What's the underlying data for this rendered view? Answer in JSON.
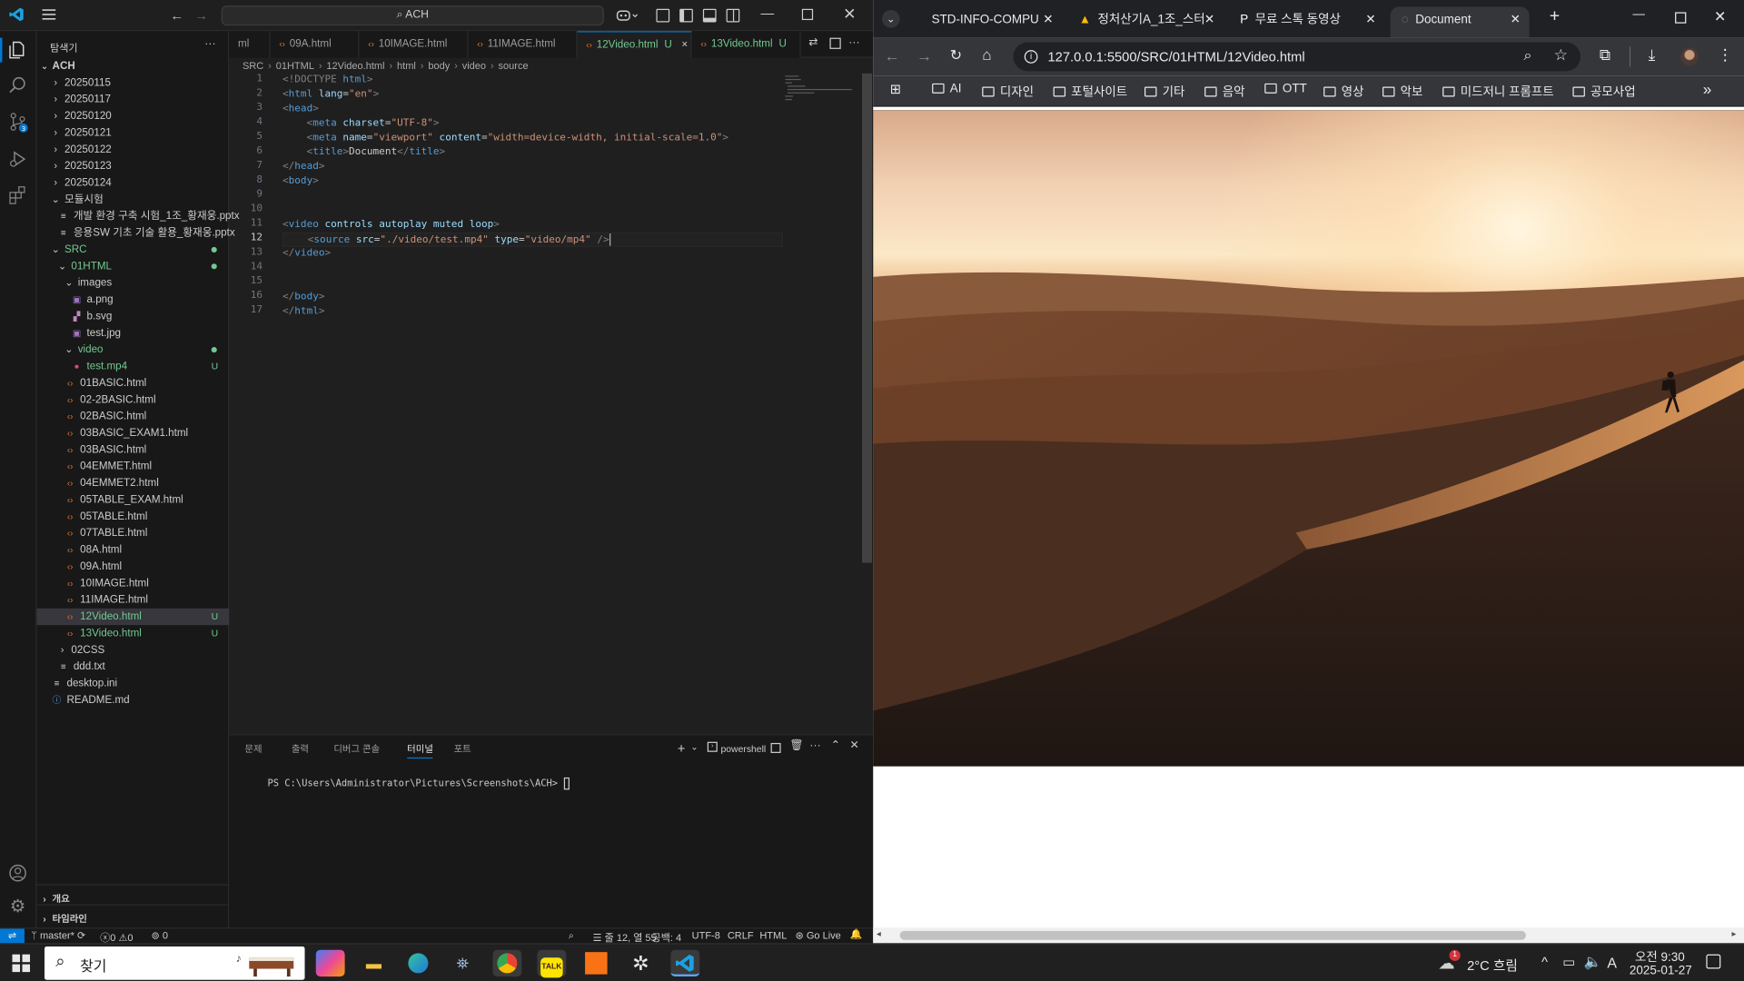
{
  "vscode": {
    "menu_icon": "hamburger-icon",
    "search_text": "ACH",
    "sidebar_title": "탐색기",
    "sidebar_more": "···",
    "root": "ACH",
    "tree": [
      {
        "label": "20250115",
        "kind": "folder",
        "depth": 0,
        "open": false
      },
      {
        "label": "20250117",
        "kind": "folder",
        "depth": 0,
        "open": false
      },
      {
        "label": "20250120",
        "kind": "folder",
        "depth": 0,
        "open": false
      },
      {
        "label": "20250121",
        "kind": "folder",
        "depth": 0,
        "open": false
      },
      {
        "label": "20250122",
        "kind": "folder",
        "depth": 0,
        "open": false
      },
      {
        "label": "20250123",
        "kind": "folder",
        "depth": 0,
        "open": false
      },
      {
        "label": "20250124",
        "kind": "folder",
        "depth": 0,
        "open": false
      },
      {
        "label": "모듈시험",
        "kind": "folder",
        "depth": 0,
        "open": true
      },
      {
        "label": "개발 환경 구축 시험_1조_황재웅.pptx",
        "kind": "file",
        "depth": 1
      },
      {
        "label": "응용SW 기초 기술 활용_황재웅.pptx",
        "kind": "file",
        "depth": 1
      },
      {
        "label": "SRC",
        "kind": "folder",
        "depth": 0,
        "open": true,
        "color": "#73c991",
        "dot": true
      },
      {
        "label": "01HTML",
        "kind": "folder",
        "depth": 1,
        "open": true,
        "color": "#73c991",
        "dot": true
      },
      {
        "label": "images",
        "kind": "folder",
        "depth": 2,
        "open": true
      },
      {
        "label": "a.png",
        "kind": "img",
        "depth": 3
      },
      {
        "label": "b.svg",
        "kind": "svg",
        "depth": 3
      },
      {
        "label": "test.jpg",
        "kind": "img",
        "depth": 3
      },
      {
        "label": "video",
        "kind": "folder",
        "depth": 2,
        "open": true,
        "color": "#73c991",
        "dot": true
      },
      {
        "label": "test.mp4",
        "kind": "mp4",
        "depth": 3,
        "color": "#73c991",
        "badge": "U"
      },
      {
        "label": "01BASIC.html",
        "kind": "html",
        "depth": 2
      },
      {
        "label": "02-2BASIC.html",
        "kind": "html",
        "depth": 2
      },
      {
        "label": "02BASIC.html",
        "kind": "html",
        "depth": 2
      },
      {
        "label": "03BASIC_EXAM1.html",
        "kind": "html",
        "depth": 2
      },
      {
        "label": "03BASIC.html",
        "kind": "html",
        "depth": 2
      },
      {
        "label": "04EMMET.html",
        "kind": "html",
        "depth": 2
      },
      {
        "label": "04EMMET2.html",
        "kind": "html",
        "depth": 2
      },
      {
        "label": "05TABLE_EXAM.html",
        "kind": "html",
        "depth": 2
      },
      {
        "label": "05TABLE.html",
        "kind": "html",
        "depth": 2
      },
      {
        "label": "07TABLE.html",
        "kind": "html",
        "depth": 2
      },
      {
        "label": "08A.html",
        "kind": "html",
        "depth": 2
      },
      {
        "label": "09A.html",
        "kind": "html",
        "depth": 2
      },
      {
        "label": "10IMAGE.html",
        "kind": "html",
        "depth": 2
      },
      {
        "label": "11IMAGE.html",
        "kind": "html",
        "depth": 2
      },
      {
        "label": "12Video.html",
        "kind": "html",
        "depth": 2,
        "color": "#73c991",
        "badge": "U",
        "selected": true
      },
      {
        "label": "13Video.html",
        "kind": "html",
        "depth": 2,
        "color": "#73c991",
        "badge": "U"
      },
      {
        "label": "02CSS",
        "kind": "folder",
        "depth": 1,
        "open": false
      },
      {
        "label": "ddd.txt",
        "kind": "file",
        "depth": 1
      },
      {
        "label": "desktop.ini",
        "kind": "file",
        "depth": 0
      },
      {
        "label": "README.md",
        "kind": "info",
        "depth": 0
      }
    ],
    "outline_label": "개요",
    "timeline_label": "타임라인",
    "tabs": [
      {
        "label": "ml",
        "active": false,
        "w": 37
      },
      {
        "label": "09A.html",
        "active": false,
        "w": 80
      },
      {
        "label": "10IMAGE.html",
        "active": false,
        "w": 98
      },
      {
        "label": "11IMAGE.html",
        "active": false,
        "w": 98
      },
      {
        "label": "12Video.html",
        "active": true,
        "badge": "U",
        "close": "×",
        "w": 103
      },
      {
        "label": "13Video.html",
        "active": false,
        "badge": "U",
        "w": 98
      }
    ],
    "breadcrumb": [
      "SRC",
      "01HTML",
      "12Video.html",
      "html",
      "body",
      "video",
      "source"
    ],
    "code": [
      [
        {
          "t": "<!DOCTYPE ",
          "c": "#808080"
        },
        {
          "t": "html",
          "c": "#569cd6"
        },
        {
          "t": ">",
          "c": "#808080"
        }
      ],
      [
        {
          "t": "<",
          "c": "#808080"
        },
        {
          "t": "html ",
          "c": "#569cd6"
        },
        {
          "t": "lang",
          "c": "#9cdcfe"
        },
        {
          "t": "=",
          "c": "#cccccc"
        },
        {
          "t": "\"en\"",
          "c": "#ce9178"
        },
        {
          "t": ">",
          "c": "#808080"
        }
      ],
      [
        {
          "t": "<",
          "c": "#808080"
        },
        {
          "t": "head",
          "c": "#569cd6"
        },
        {
          "t": ">",
          "c": "#808080"
        }
      ],
      [
        {
          "t": "    <",
          "c": "#808080"
        },
        {
          "t": "meta ",
          "c": "#569cd6"
        },
        {
          "t": "charset",
          "c": "#9cdcfe"
        },
        {
          "t": "=",
          "c": "#cccccc"
        },
        {
          "t": "\"UTF-8\"",
          "c": "#ce9178"
        },
        {
          "t": ">",
          "c": "#808080"
        }
      ],
      [
        {
          "t": "    <",
          "c": "#808080"
        },
        {
          "t": "meta ",
          "c": "#569cd6"
        },
        {
          "t": "name",
          "c": "#9cdcfe"
        },
        {
          "t": "=",
          "c": "#cccccc"
        },
        {
          "t": "\"viewport\" ",
          "c": "#ce9178"
        },
        {
          "t": "content",
          "c": "#9cdcfe"
        },
        {
          "t": "=",
          "c": "#cccccc"
        },
        {
          "t": "\"width=device-width, initial-scale=1.0\"",
          "c": "#ce9178"
        },
        {
          "t": ">",
          "c": "#808080"
        }
      ],
      [
        {
          "t": "    <",
          "c": "#808080"
        },
        {
          "t": "title",
          "c": "#569cd6"
        },
        {
          "t": ">",
          "c": "#808080"
        },
        {
          "t": "Document",
          "c": "#cccccc"
        },
        {
          "t": "</",
          "c": "#808080"
        },
        {
          "t": "title",
          "c": "#569cd6"
        },
        {
          "t": ">",
          "c": "#808080"
        }
      ],
      [
        {
          "t": "</",
          "c": "#808080"
        },
        {
          "t": "head",
          "c": "#569cd6"
        },
        {
          "t": ">",
          "c": "#808080"
        }
      ],
      [
        {
          "t": "<",
          "c": "#808080"
        },
        {
          "t": "body",
          "c": "#569cd6"
        },
        {
          "t": ">",
          "c": "#808080"
        }
      ],
      [],
      [],
      [
        {
          "t": "<",
          "c": "#808080"
        },
        {
          "t": "video ",
          "c": "#569cd6"
        },
        {
          "t": "controls autoplay muted loop",
          "c": "#9cdcfe"
        },
        {
          "t": ">",
          "c": "#808080"
        }
      ],
      [
        {
          "t": "    <",
          "c": "#808080"
        },
        {
          "t": "source ",
          "c": "#569cd6"
        },
        {
          "t": "src",
          "c": "#9cdcfe"
        },
        {
          "t": "=",
          "c": "#cccccc"
        },
        {
          "t": "\"./video/test.mp4\" ",
          "c": "#ce9178"
        },
        {
          "t": "type",
          "c": "#9cdcfe"
        },
        {
          "t": "=",
          "c": "#cccccc"
        },
        {
          "t": "\"video/mp4\"",
          "c": "#ce9178"
        },
        {
          "t": " />",
          "c": "#808080"
        }
      ],
      [
        {
          "t": "</",
          "c": "#808080"
        },
        {
          "t": "video",
          "c": "#569cd6"
        },
        {
          "t": ">",
          "c": "#808080"
        }
      ],
      [],
      [],
      [
        {
          "t": "</",
          "c": "#808080"
        },
        {
          "t": "body",
          "c": "#569cd6"
        },
        {
          "t": ">",
          "c": "#808080"
        }
      ],
      [
        {
          "t": "</",
          "c": "#808080"
        },
        {
          "t": "html",
          "c": "#569cd6"
        },
        {
          "t": ">",
          "c": "#808080"
        }
      ]
    ],
    "panel_tabs": [
      {
        "label": "문제",
        "active": false
      },
      {
        "label": "출력",
        "active": false
      },
      {
        "label": "디버그 콘솔",
        "active": false
      },
      {
        "label": "터미널",
        "active": true
      },
      {
        "label": "포트",
        "active": false
      }
    ],
    "terminal_shell": "powershell",
    "terminal_prompt": "PS C:\\Users\\Administrator\\Pictures\\Screenshots\\ACH> ",
    "status": {
      "branch": "master*",
      "errors": "0",
      "warnings": "0",
      "ports": "0",
      "position": "줄 12, 열 55",
      "spaces": "공백: 4",
      "encoding": "UTF-8",
      "eol": "CRLF",
      "language": "HTML",
      "golive": "Go Live"
    }
  },
  "browser": {
    "tabs": [
      {
        "label": "STD-INFO-COMPU",
        "active": false
      },
      {
        "label": "정처산기A_1조_스터",
        "active": false
      },
      {
        "label": "무료 스톡 동영상",
        "active": false
      },
      {
        "label": "Document",
        "active": true
      }
    ],
    "new_tab": "+",
    "url": "127.0.0.1:5500/SRC/01HTML/12Video.html",
    "bookmarks": [
      "AI",
      "디자인",
      "포털사이트",
      "기타",
      "음악",
      "OTT",
      "영상",
      "악보",
      "미드저니 프롬프트",
      "공모사업"
    ],
    "more_bookmarks": "»"
  },
  "taskbar": {
    "search_placeholder": "찾기",
    "weather": "2°C 흐림",
    "notification_count": "1",
    "ime": "A",
    "time": "오전 9:30",
    "date": "2025-01-27"
  },
  "colors": {
    "accent": "#0078d4",
    "git_untracked": "#73c991",
    "html_icon": "#e37933",
    "status_remote": "#0078d4"
  }
}
